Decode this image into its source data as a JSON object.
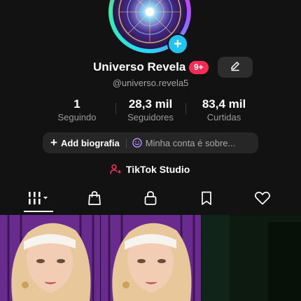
{
  "profile": {
    "display_name": "Universo Revela",
    "notification_badge": "9+",
    "username": "@universo.revela5"
  },
  "stats": [
    {
      "value": "1",
      "label": "Seguindo"
    },
    {
      "value": "28,3 mil",
      "label": "Seguidores"
    },
    {
      "value": "83,4 mil",
      "label": "Curtidas"
    }
  ],
  "bio": {
    "add_label": "Add biografia",
    "about_label": "Minha conta é sobre..."
  },
  "studio": {
    "label": "TikTok Studio"
  },
  "tabs": [
    {
      "icon": "videos-grid-icon",
      "active": true
    },
    {
      "icon": "shopping-bag-icon",
      "active": false
    },
    {
      "icon": "lock-icon",
      "active": false
    },
    {
      "icon": "bookmark-icon",
      "active": false
    },
    {
      "icon": "heart-icon",
      "active": false
    }
  ],
  "colors": {
    "background": "#121212",
    "badge": "#fe2c55",
    "add_avatar": "#20c4ee",
    "pill": "#262626",
    "muted_text": "#a6a6a6",
    "studio_icon": "#fe2c55"
  }
}
